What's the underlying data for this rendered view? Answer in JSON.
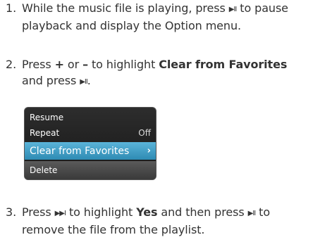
{
  "steps": [
    {
      "number": "1.",
      "line1": "While the music file is playing, press ",
      "line1_tail": " to pause",
      "line2": "playback and display the Option menu."
    },
    {
      "number": "2.",
      "t1": "Press ",
      "plus": "+",
      "t2": " or ",
      "minus": "–",
      "t3": " to highlight ",
      "bold": "Clear from Favorites",
      "t4": "and press ",
      "t5": "."
    },
    {
      "number": "3.",
      "t1": "Press ",
      "t2": " to highlight ",
      "bold": "Yes",
      "t3": " and then press ",
      "t4": " to",
      "line2": "remove the file from the playlist."
    }
  ],
  "glyphs": {
    "play_pause": "▶II",
    "skip_forward": "▶▶I"
  },
  "option_menu": {
    "items": [
      {
        "label": "Resume",
        "value": ""
      },
      {
        "label": "Repeat",
        "value": "Off"
      },
      {
        "label": "Clear from Favorites",
        "value": "›",
        "selected": true
      },
      {
        "label": "Delete",
        "value": ""
      }
    ]
  },
  "colors": {
    "text": "#333333",
    "highlight": "#3a9cc7",
    "screen_bg": "#1e1e1e"
  }
}
